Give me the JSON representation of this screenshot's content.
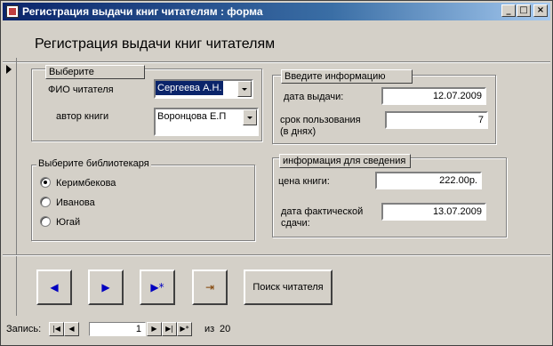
{
  "window": {
    "title": "Регистрация выдачи книг читателям : форма",
    "minimize": "_",
    "maximize": "□",
    "close": "×"
  },
  "header": {
    "title": "Регистрация выдачи книг читателям"
  },
  "select_group": {
    "label": "Выберите",
    "reader_label": "ФИО читателя",
    "reader_value": "Сергеева А.Н.",
    "author_label": "автор книги",
    "author_value": "Воронцова Е.П"
  },
  "librarian_group": {
    "label": "Выберите библиотекаря",
    "options": [
      {
        "label": "Керимбекова",
        "selected": true
      },
      {
        "label": "Иванова",
        "selected": false
      },
      {
        "label": "Югай",
        "selected": false
      }
    ]
  },
  "input_group": {
    "label": "Введите информацию",
    "issue_date_label": "дата выдачи:",
    "issue_date_value": "12.07.2009",
    "term_label_line1": "срок пользования",
    "term_label_line2": "(в днях)",
    "term_value": "7"
  },
  "info_group": {
    "label": "информация для сведения",
    "price_label": "цена книги:",
    "price_value": "222.00р.",
    "actual_date_label_line1": "дата фактической",
    "actual_date_label_line2": "сдачи:",
    "actual_date_value": "13.07.2009"
  },
  "buttons": {
    "prev_glyph": "◀",
    "next_glyph": "▶",
    "new_glyph": "▶*",
    "exit_glyph": "⇥",
    "search_label": "Поиск читателя"
  },
  "record_nav": {
    "label": "Запись:",
    "first": "|◀",
    "prev": "◀",
    "current": "1",
    "next": "▶",
    "last": "▶|",
    "new": "▶*",
    "of_label": "из",
    "total": "20"
  }
}
